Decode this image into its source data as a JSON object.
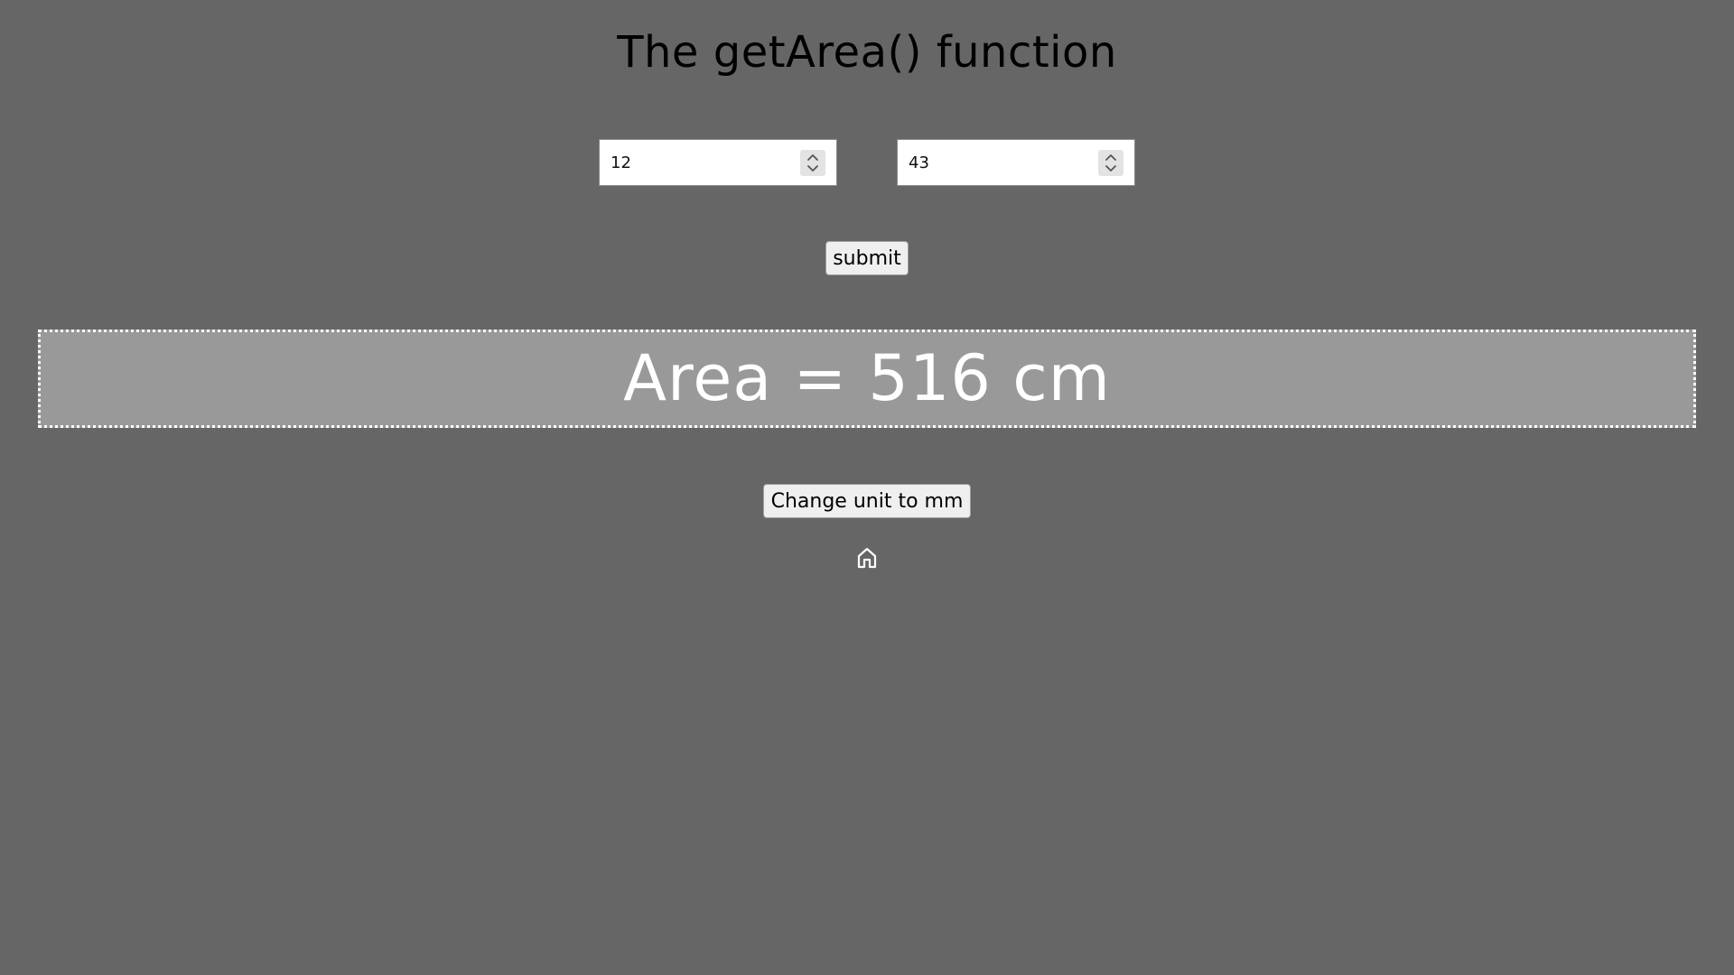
{
  "page": {
    "title": "The getArea() function"
  },
  "inputs": {
    "width_value": "12",
    "height_value": "43"
  },
  "buttons": {
    "submit_label": "submit",
    "change_unit_label": "Change unit to mm"
  },
  "result": {
    "text": "Area = 516 cm"
  },
  "icons": {
    "home": "home-icon",
    "spinner_up": "chevron-up-icon",
    "spinner_down": "chevron-down-icon"
  },
  "colors": {
    "background": "#666666",
    "result_background": "#999999",
    "result_text": "#ffffff",
    "input_background": "#ffffff",
    "button_background": "#efefef"
  }
}
